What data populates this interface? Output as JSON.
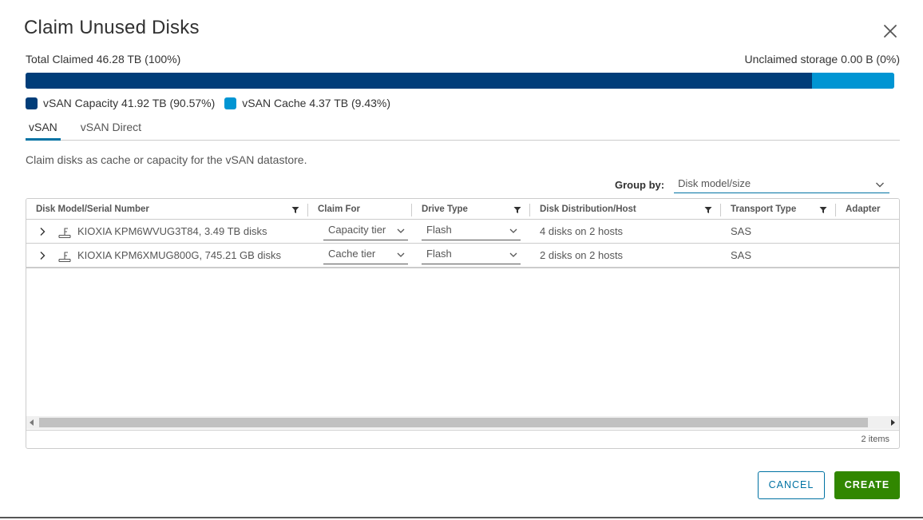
{
  "dialog": {
    "title": "Claim Unused Disks",
    "close_icon": "close-icon"
  },
  "summary": {
    "total_claimed": "Total Claimed 46.28 TB (100%)",
    "unclaimed": "Unclaimed storage 0.00 B (0%)"
  },
  "storage_bar": {
    "capacity_fraction": 0.9057,
    "cache_fraction": 0.0943,
    "capacity_color": "#003d79",
    "cache_color": "#0095d3"
  },
  "legend": {
    "capacity": "vSAN Capacity 41.92 TB (90.57%)",
    "cache": "vSAN Cache 4.37 TB (9.43%)"
  },
  "tabs": [
    {
      "label": "vSAN",
      "active": true
    },
    {
      "label": "vSAN Direct",
      "active": false
    }
  ],
  "description": "Claim disks as cache or capacity for the vSAN datastore.",
  "group_by": {
    "label": "Group by:",
    "value": "Disk model/size"
  },
  "grid": {
    "columns": [
      {
        "label": "Disk Model/Serial Number",
        "filter": true
      },
      {
        "label": "Claim For",
        "filter": false
      },
      {
        "label": "Drive Type",
        "filter": true
      },
      {
        "label": "Disk Distribution/Host",
        "filter": true
      },
      {
        "label": "Transport Type",
        "filter": true
      },
      {
        "label": "Adapter",
        "filter": false
      }
    ],
    "rows": [
      {
        "model": "KIOXIA KPM6WVUG3T84, 3.49 TB disks",
        "claim_for": "Capacity tier",
        "drive_type": "Flash",
        "distribution": "4 disks on 2 hosts",
        "transport": "SAS",
        "adapter": ""
      },
      {
        "model": "KIOXIA KPM6XMUG800G, 745.21 GB disks",
        "claim_for": "Cache tier",
        "drive_type": "Flash",
        "distribution": "2 disks on 2 hosts",
        "transport": "SAS",
        "adapter": ""
      }
    ],
    "footer": "2 items"
  },
  "buttons": {
    "cancel": "CANCEL",
    "create": "CREATE"
  },
  "colors": {
    "primary": "#0072a3",
    "success": "#318700",
    "capacity": "#003d79",
    "cache": "#0095d3"
  }
}
